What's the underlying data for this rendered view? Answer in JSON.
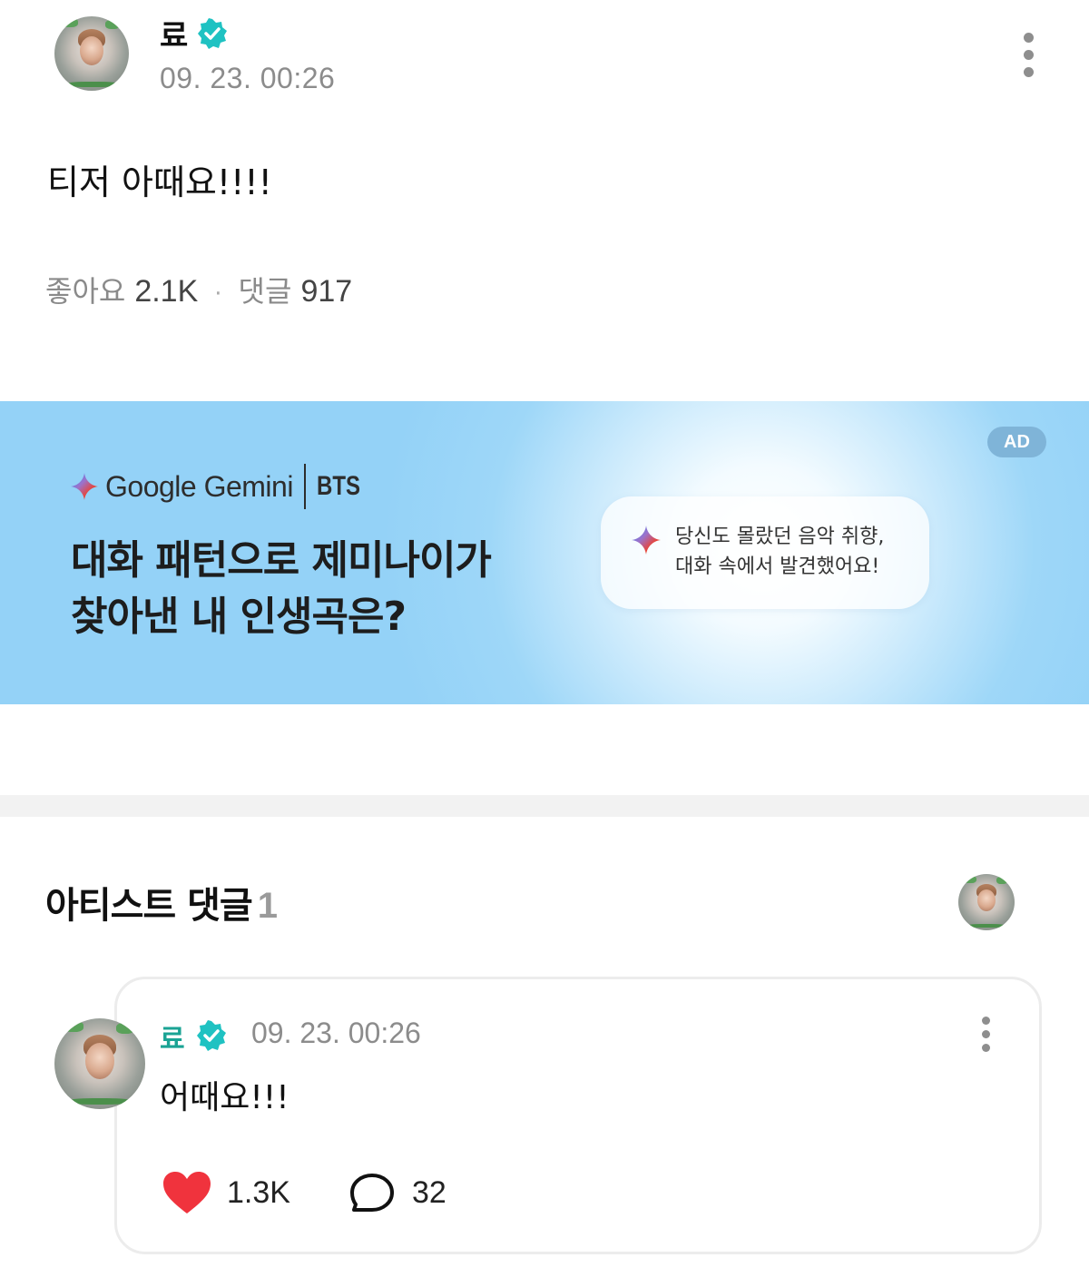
{
  "post": {
    "author": "료",
    "date": "09. 23. 00:26",
    "text": "티저 아때요!!!!",
    "likes_label": "좋아요",
    "likes_count": "2.1K",
    "separator": "·",
    "comments_label": "댓글",
    "comments_count": "917"
  },
  "ad": {
    "badge": "AD",
    "brand": "Google Gemini",
    "partner": "BTS",
    "headline_line1": "대화 패턴으로 제미나이가",
    "headline_line2": "찾아낸 내 인생곡은?",
    "bubble_line1": "당신도 몰랐던 음악 취향,",
    "bubble_line2": "대화 속에서 발견했어요!"
  },
  "artist_comments": {
    "title": "아티스트 댓글",
    "count": "1",
    "comment": {
      "author": "료",
      "date": "09. 23. 00:26",
      "text": "어때요!!!",
      "likes": "1.3K",
      "replies": "32"
    }
  },
  "colors": {
    "verified": "#1fc2c2",
    "comment_author": "#1aa394",
    "heart": "#f0333d",
    "ad_background": "#94d2f7"
  },
  "icons": [
    "verified-badge-icon",
    "more-options-icon",
    "gemini-sparkle-icon",
    "heart-icon",
    "comment-bubble-icon"
  ]
}
